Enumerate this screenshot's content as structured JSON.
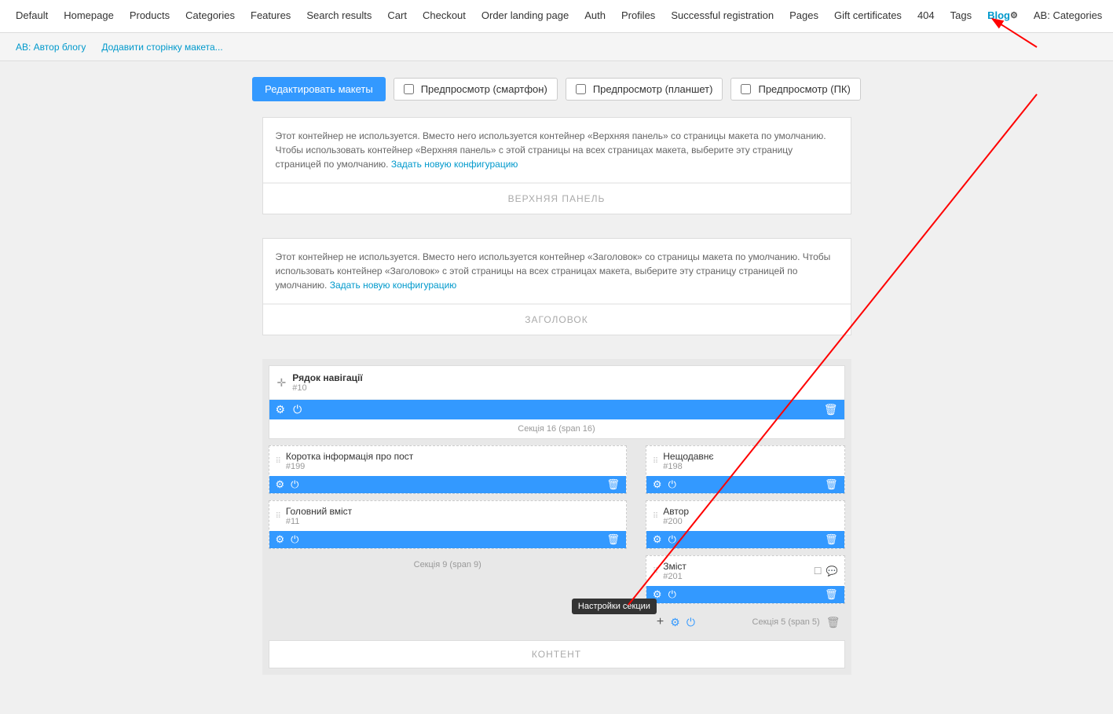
{
  "topNav": {
    "items": [
      {
        "label": "Default",
        "active": false
      },
      {
        "label": "Homepage",
        "active": false
      },
      {
        "label": "Products",
        "active": false
      },
      {
        "label": "Categories",
        "active": false
      },
      {
        "label": "Features",
        "active": false
      },
      {
        "label": "Search results",
        "active": false
      },
      {
        "label": "Cart",
        "active": false
      },
      {
        "label": "Checkout",
        "active": false
      },
      {
        "label": "Order landing page",
        "active": false
      },
      {
        "label": "Auth",
        "active": false
      },
      {
        "label": "Profiles",
        "active": false
      },
      {
        "label": "Successful registration",
        "active": false
      },
      {
        "label": "Pages",
        "active": false
      },
      {
        "label": "Gift certificates",
        "active": false
      },
      {
        "label": "404",
        "active": false
      },
      {
        "label": "Tags",
        "active": false
      },
      {
        "label": "Blog",
        "active": true,
        "hasGear": true
      },
      {
        "label": "AB: Categories",
        "active": false
      }
    ]
  },
  "secNav": {
    "items": [
      {
        "label": "AB: Автор блогу"
      },
      {
        "label": "Додавити сторінку макета..."
      }
    ]
  },
  "toolbar": {
    "editBtn": "Редактировать макеты",
    "preview1": "Предпросмотр (смартфон)",
    "preview2": "Предпросмотр (планшет)",
    "preview3": "Предпросмотр (ПК)"
  },
  "container1": {
    "notice": "Этот контейнер не используется. Вместо него используется контейнер «Верхняя панель» со страницы макета по умолчанию. Чтобы использовать контейнер «Верхняя панель» с этой страницы на всех страницах макета, выберите эту страницу страницей по умолчанию.",
    "link": "Задать новую конфигурацию",
    "label": "ВЕРХНЯЯ ПАНЕЛЬ"
  },
  "container2": {
    "notice": "Этот контейнер не используется. Вместо него используется контейнер «Заголовок» со страницы макета по умолчанию. Чтобы использовать контейнер «Заголовок» с этой страницы на всех страницах макета, выберите эту страницу страницей по умолчанию.",
    "link": "Задать новую конфигурацию",
    "label": "ЗАГОЛОВОК"
  },
  "layoutEditor": {
    "row": {
      "title": "Рядок навігації",
      "id": "#10",
      "sectionLabel": "Секція 16 (span 16)"
    },
    "colLeft": {
      "widgets": [
        {
          "title": "Коротка інформація про пост",
          "id": "#199"
        },
        {
          "title": "Головний вміст",
          "id": "#11"
        }
      ],
      "sectionLabel": "Секція 9 (span 9)"
    },
    "colRight": {
      "widgets": [
        {
          "title": "Нещодавнє",
          "id": "#198"
        },
        {
          "title": "Автор",
          "id": "#200"
        },
        {
          "title": "Зміст",
          "id": "#201",
          "hasExtraIcons": true
        }
      ],
      "sectionLabel": "Секція 5 (span 5)"
    },
    "tooltip": "Настройки секции",
    "contentLabel": "КОНТЕНТ"
  }
}
